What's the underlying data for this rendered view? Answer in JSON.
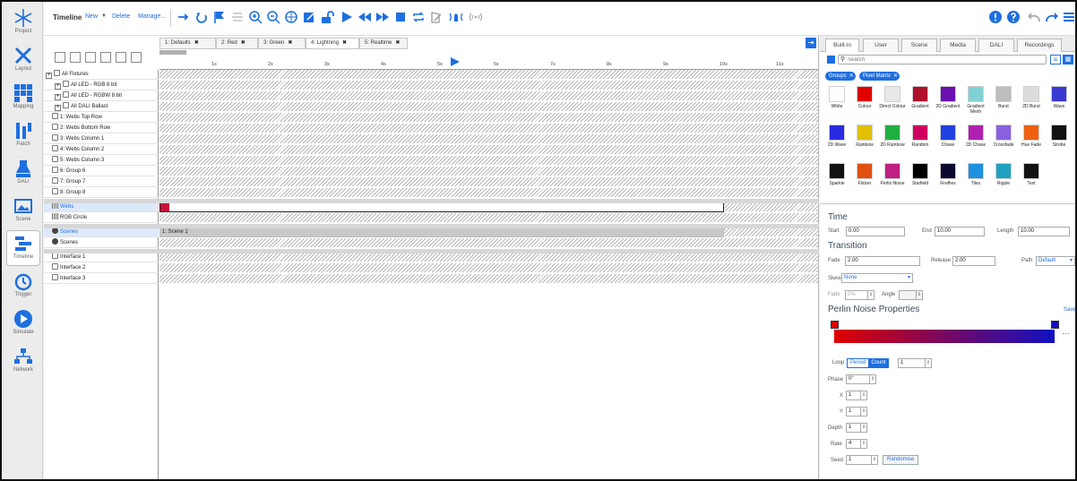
{
  "sidebar": {
    "items": [
      {
        "label": "Project",
        "icon": "snowflake-icon"
      },
      {
        "label": "Layout",
        "icon": "layout-tools-icon"
      },
      {
        "label": "Mapping",
        "icon": "grid-icon"
      },
      {
        "label": "Patch",
        "icon": "patch-plug-icon"
      },
      {
        "label": "DALI",
        "icon": "dali-lamp-icon"
      },
      {
        "label": "Scene",
        "icon": "scene-picture-icon"
      },
      {
        "label": "Timeline",
        "icon": "timeline-icon"
      },
      {
        "label": "Trigger",
        "icon": "clock-icon"
      },
      {
        "label": "Simulate",
        "icon": "play-circle-icon"
      },
      {
        "label": "Network",
        "icon": "network-icon"
      }
    ],
    "active": "Timeline"
  },
  "toolbar": {
    "title": "Timeline",
    "new_label": "New",
    "delete_label": "Delete",
    "manage_label": "Manage..."
  },
  "tabs": [
    {
      "label": "1: Defaults"
    },
    {
      "label": "2: Red"
    },
    {
      "label": "3: Green"
    },
    {
      "label": "4: Lightning"
    },
    {
      "label": "5: Realtime"
    }
  ],
  "ruler": {
    "ticks": [
      "1s",
      "2s",
      "3s",
      "4s",
      "5s",
      "6s",
      "7s",
      "8s",
      "9s",
      "10s",
      "11s"
    ]
  },
  "tree": {
    "rows": [
      {
        "label": "All Fixtures"
      },
      {
        "label": "All LED - RGB 8 bit"
      },
      {
        "label": "All LED - RGBW 8 bit"
      },
      {
        "label": "All DALI Ballast"
      },
      {
        "label": "1: Webs Top Row"
      },
      {
        "label": "2: Webs Bottom Row"
      },
      {
        "label": "3: Webs Column 1"
      },
      {
        "label": "4: Webs Column 2"
      },
      {
        "label": "5: Webs Column 3"
      },
      {
        "label": "6: Group 6"
      },
      {
        "label": "7: Group 7"
      },
      {
        "label": "8: Group 8"
      },
      {
        "label": "Webs"
      },
      {
        "label": "RGB Circle"
      },
      {
        "label": "Scenes"
      },
      {
        "label": "Scenes"
      },
      {
        "label": "Interface 1"
      },
      {
        "label": "Interface 2"
      },
      {
        "label": "Interface 3"
      }
    ]
  },
  "timeline": {
    "scene_bar_label": "1: Scene 1"
  },
  "panel": {
    "tabs": [
      {
        "label": "Built-in"
      },
      {
        "label": "User"
      },
      {
        "label": "Scene"
      },
      {
        "label": "Media"
      },
      {
        "label": "DALI"
      },
      {
        "label": "Recordings"
      }
    ],
    "search_placeholder": "Search",
    "filters": [
      {
        "label": "Groups"
      },
      {
        "label": "Pixel Matrix"
      }
    ],
    "effects": [
      {
        "label": "White",
        "swatch": "#ffffff"
      },
      {
        "label": "Colour",
        "swatch": "#e00000"
      },
      {
        "label": "Direct Colour",
        "swatch": "#e8e8e8"
      },
      {
        "label": "Gradient",
        "swatch": "#b0102a"
      },
      {
        "label": "2D Gradient",
        "swatch": "#6a0fb0"
      },
      {
        "label": "Gradient Mesh",
        "swatch": "#7fd1d4"
      },
      {
        "label": "Burst",
        "swatch": "#bdbdbd"
      },
      {
        "label": "2D Burst",
        "swatch": "#dcdcdc"
      },
      {
        "label": "Wave",
        "swatch": "#3a3ad0"
      },
      {
        "label": "2D Wave",
        "swatch": "#2a2ae0"
      },
      {
        "label": "Rainbow",
        "swatch": "#e0c000"
      },
      {
        "label": "2D Rainbow",
        "swatch": "#20b040"
      },
      {
        "label": "Random",
        "swatch": "#d00060"
      },
      {
        "label": "Chase",
        "swatch": "#2040e0"
      },
      {
        "label": "2D Chase",
        "swatch": "#b020b0"
      },
      {
        "label": "Crossfade",
        "swatch": "#8a60e0"
      },
      {
        "label": "Hue Fade",
        "swatch": "#f06010"
      },
      {
        "label": "Strobe",
        "swatch": "#111111"
      },
      {
        "label": "Sparkle",
        "swatch": "#111111"
      },
      {
        "label": "Flicker",
        "swatch": "#e05010"
      },
      {
        "label": "Perlin Noise",
        "swatch": "#c02080"
      },
      {
        "label": "Starfield",
        "swatch": "#000000"
      },
      {
        "label": "Fireflies",
        "swatch": "#0a0a30"
      },
      {
        "label": "Tiles",
        "swatch": "#2090e0"
      },
      {
        "label": "Ripple",
        "swatch": "#20a0c0"
      },
      {
        "label": "Text",
        "swatch": "#111111"
      }
    ],
    "time": {
      "heading": "Time",
      "start_label": "Start",
      "start": "0.00",
      "end_label": "End",
      "end": "10.00",
      "length_label": "Length",
      "length": "10.00"
    },
    "transition": {
      "heading": "Transition",
      "fade_label": "Fade",
      "fade": "2.00",
      "release_label": "Release",
      "release": "2.00",
      "path_label": "Path",
      "path": "Default",
      "skew_label": "Skew",
      "skew": "None",
      "fade2_label": "Fade",
      "fade2": "0%",
      "angle_label": "Angle"
    },
    "props": {
      "heading": "Perlin Noise Properties",
      "save_label": "Save",
      "gradient_start": "#e00000",
      "gradient_end": "#1010c0",
      "loop_label": "Loop",
      "loop_period": "Period",
      "loop_count": "Count",
      "loop_value": "1",
      "phase_label": "Phase",
      "phase": "0°",
      "x_label": "X",
      "x": "1",
      "y_label": "Y",
      "y": "1",
      "depth_label": "Depth",
      "depth": "1",
      "rate_label": "Rate",
      "rate": "4",
      "seed_label": "Seed",
      "seed": "1",
      "randomise_label": "Randomise"
    }
  },
  "colors": {
    "accent": "#1e6fe0",
    "timeline_bar": "#c8103a"
  }
}
